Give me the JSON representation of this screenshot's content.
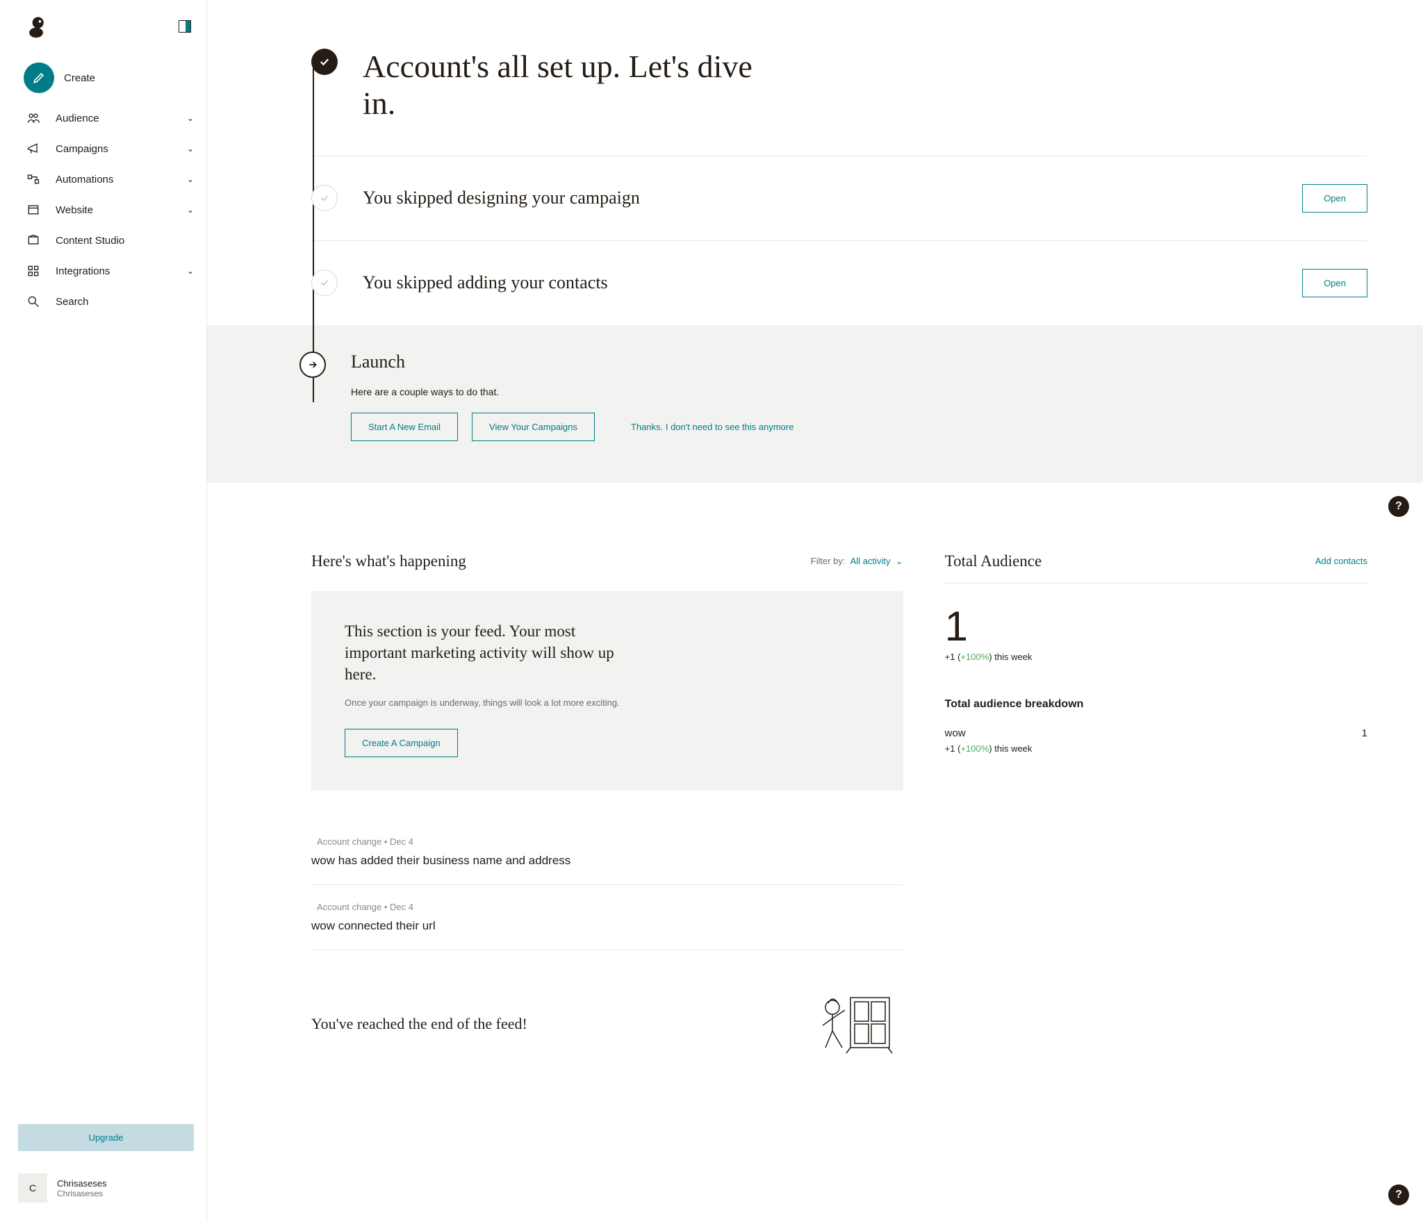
{
  "sidebar": {
    "create_label": "Create",
    "items": [
      {
        "label": "Audience",
        "expandable": true
      },
      {
        "label": "Campaigns",
        "expandable": true
      },
      {
        "label": "Automations",
        "expandable": true
      },
      {
        "label": "Website",
        "expandable": true
      },
      {
        "label": "Content Studio",
        "expandable": false
      },
      {
        "label": "Integrations",
        "expandable": true
      },
      {
        "label": "Search",
        "expandable": false
      }
    ],
    "upgrade_label": "Upgrade",
    "account_name": "Chrisaseses",
    "account_sub": "Chrisaseses",
    "avatar_letter": "C"
  },
  "setup": {
    "headline": "Account's all set up. Let's dive in.",
    "skipped_campaign": "You skipped designing your campaign",
    "skipped_contacts": "You skipped adding your contacts",
    "open_label": "Open",
    "launch_title": "Launch",
    "launch_sub": "Here are a couple ways to do that.",
    "start_email": "Start A New Email",
    "view_campaigns": "View Your Campaigns",
    "dismiss": "Thanks. I don't need to see this anymore"
  },
  "feed": {
    "header": "Here's what's happening",
    "filter_label": "Filter by:",
    "filter_value": "All activity",
    "card_title": "This section is your feed. Your most important marketing activity will show up here.",
    "card_sub": "Once your campaign is underway, things will look a lot more exciting.",
    "card_cta": "Create A Campaign",
    "items": [
      {
        "meta": "Account change  • Dec 4",
        "text": "wow has added their business name and address"
      },
      {
        "meta": "Account change  • Dec 4",
        "text": "wow connected their url"
      }
    ],
    "end_text": "You've reached the end of the feed!"
  },
  "audience": {
    "title": "Total Audience",
    "add_link": "Add contacts",
    "total": "1",
    "delta_prefix": "+1 (",
    "delta_pct": "+100%",
    "delta_suffix": ") this week",
    "breakdown_title": "Total audience breakdown",
    "breakdown_name": "wow",
    "breakdown_count": "1"
  }
}
